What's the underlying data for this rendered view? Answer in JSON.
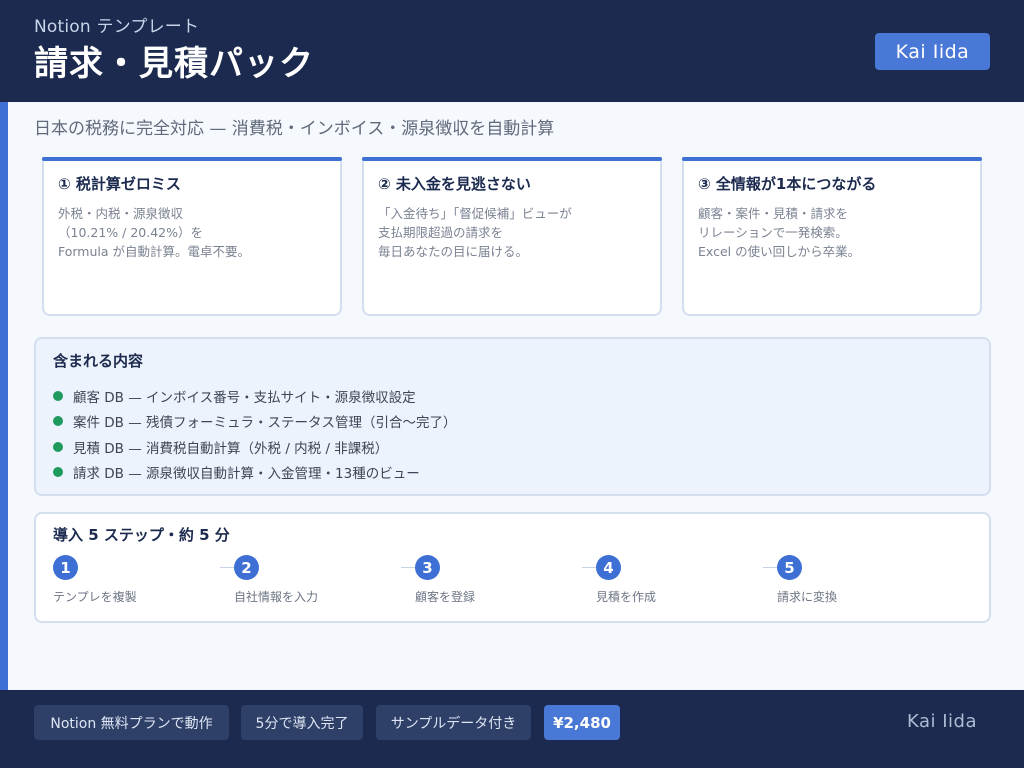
{
  "header": {
    "eyebrow": "Notion テンプレート",
    "title": "請求・見積パック",
    "author": "Kai Iida"
  },
  "subtitle": "日本の税務に完全対応 — 消費税・インボイス・源泉徴収を自動計算",
  "cards": [
    {
      "title": "① 税計算ゼロミス",
      "body": "外税・内税・源泉徴収\n（10.21% / 20.42%）を\nFormula が自動計算。電卓不要。"
    },
    {
      "title": "② 未入金を見逃さない",
      "body": "「入金待ち」「督促候補」ビューが\n支払期限超過の請求を\n毎日あなたの目に届ける。"
    },
    {
      "title": "③ 全情報が1本につながる",
      "body": "顧客・案件・見積・請求を\nリレーションで一発検索。\nExcel の使い回しから卒業。"
    }
  ],
  "contents": {
    "title": "含まれる内容",
    "items": [
      "顧客 DB — インボイス番号・支払サイト・源泉徴収設定",
      "案件 DB — 残債フォーミュラ・ステータス管理（引合〜完了）",
      "見積 DB — 消費税自動計算（外税 / 内税 / 非課税）",
      "請求 DB — 源泉徴収自動計算・入金管理・13種のビュー"
    ]
  },
  "steps": {
    "title": "導入 5 ステップ・約 5 分",
    "items": [
      {
        "num": "1",
        "label": "テンプレを複製"
      },
      {
        "num": "2",
        "label": "自社情報を入力"
      },
      {
        "num": "3",
        "label": "顧客を登録"
      },
      {
        "num": "4",
        "label": "見積を作成"
      },
      {
        "num": "5",
        "label": "請求に変換"
      }
    ]
  },
  "footer": {
    "pills": [
      "Notion 無料プランで動作",
      "5分で導入完了",
      "サンプルデータ付き"
    ],
    "price": "¥2,480",
    "author": "Kai Iida"
  },
  "colors": {
    "navy": "#1b2a4e",
    "accent": "#3d6fd4",
    "bullet_green": "#1f9a5f"
  }
}
